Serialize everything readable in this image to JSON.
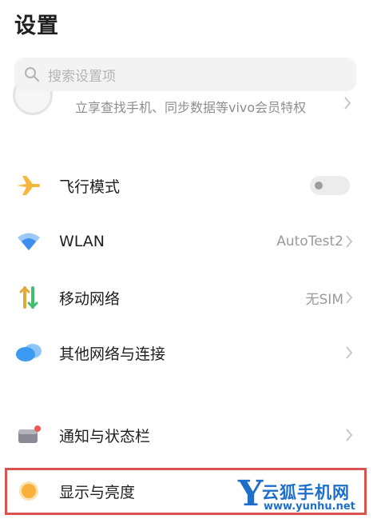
{
  "header": {
    "title": "设置"
  },
  "search": {
    "placeholder": "搜索设置项"
  },
  "account": {
    "subtitle": "立享查找手机、同步数据等vivo会员特权"
  },
  "settings": [
    {
      "id": "airplane",
      "label": "飞行模式",
      "value": "",
      "icon": "airplane-icon",
      "control": "toggle",
      "toggle_on": false
    },
    {
      "id": "wlan",
      "label": "WLAN",
      "value": "AutoTest2",
      "icon": "wifi-icon",
      "control": "chevron"
    },
    {
      "id": "mobile",
      "label": "移动网络",
      "value": "无SIM",
      "icon": "mobile-data-icon",
      "control": "chevron"
    },
    {
      "id": "other-network",
      "label": "其他网络与连接",
      "value": "",
      "icon": "cloud-icon",
      "control": "chevron"
    },
    {
      "id": "notification",
      "label": "通知与状态栏",
      "value": "",
      "icon": "notification-icon",
      "control": "chevron"
    },
    {
      "id": "display",
      "label": "显示与亮度",
      "value": "",
      "icon": "brightness-icon",
      "control": "none",
      "highlighted": true
    }
  ],
  "watermark": {
    "letter": "Y",
    "name": "云狐手机网",
    "url": "www.yunhu.net"
  },
  "colors": {
    "airplane": "#f6b73c",
    "wifi": "#3d8ef0",
    "mobile_up": "#e5a93a",
    "mobile_down": "#3fbf6f",
    "cloud": "#3c9af2",
    "brightness": "#f8b13b",
    "highlight": "#d9534f",
    "watermark": "#1e6fc9"
  }
}
